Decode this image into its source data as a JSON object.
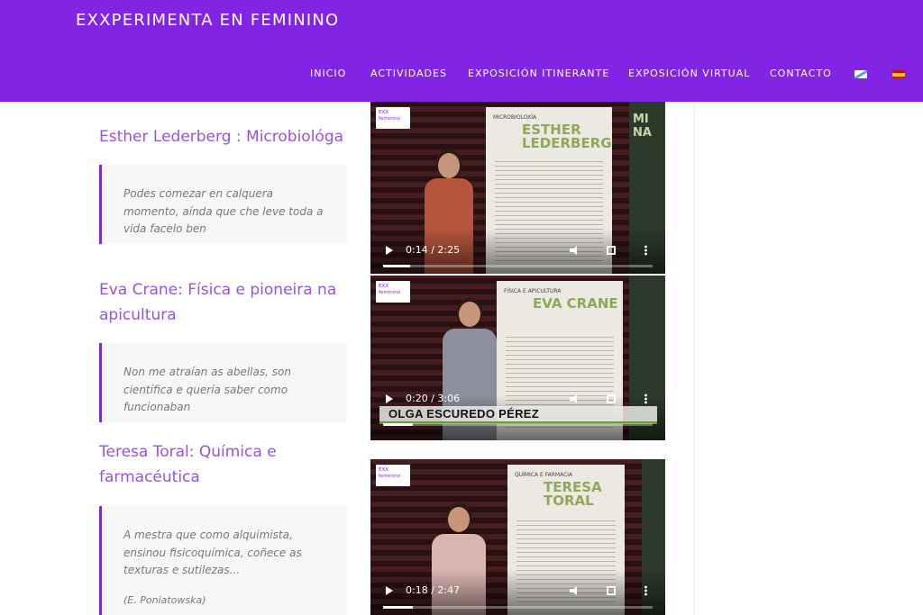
{
  "site": {
    "title": "EXXPERIMENTA EN FEMININO"
  },
  "nav": {
    "items": [
      {
        "label": "INICIO"
      },
      {
        "label": "ACTIVIDADES"
      },
      {
        "label": "EXPOSICIÓN ITINERANTE"
      },
      {
        "label": "EXPOSICIÓN VIRTUAL"
      },
      {
        "label": "CONTACTO"
      }
    ],
    "flags": [
      "galician-flag-icon",
      "spanish-flag-icon"
    ]
  },
  "colors": {
    "accent": "#8224e3",
    "title": "#9b51e0",
    "quote_text": "#777777"
  },
  "entries": [
    {
      "title": "Esther Lederberg : Microbiológa",
      "quote": [
        "Podes comezar en calquera momento, aínda que che leve toda a vida facelo ben"
      ],
      "video": {
        "time": "0:14 / 2:25",
        "progress": 0.1,
        "poster_name": "ESTHER LEDERBERG"
      }
    },
    {
      "title": "Eva Crane: Física e pioneira na apicultura",
      "quote": [
        "Non me atraían as abellas, son científica e quería saber como funcionaban"
      ],
      "video": {
        "time": "0:20 / 3:06",
        "progress": 0.11,
        "poster_name": "EVA CRANE",
        "caption": "OLGA ESCUREDO PÉREZ"
      }
    },
    {
      "title": "Teresa Toral: Química e farmacéutica",
      "quote": [
        "A mestra que como alquimista, ensinou fisicoquímica, coñece as texturas e sutilezas..."
      ],
      "cite": "(E. Poniatowska)",
      "video": {
        "time": "0:18 / 2:47",
        "progress": 0.11,
        "poster_name": "TERESA TORAL"
      }
    }
  ]
}
